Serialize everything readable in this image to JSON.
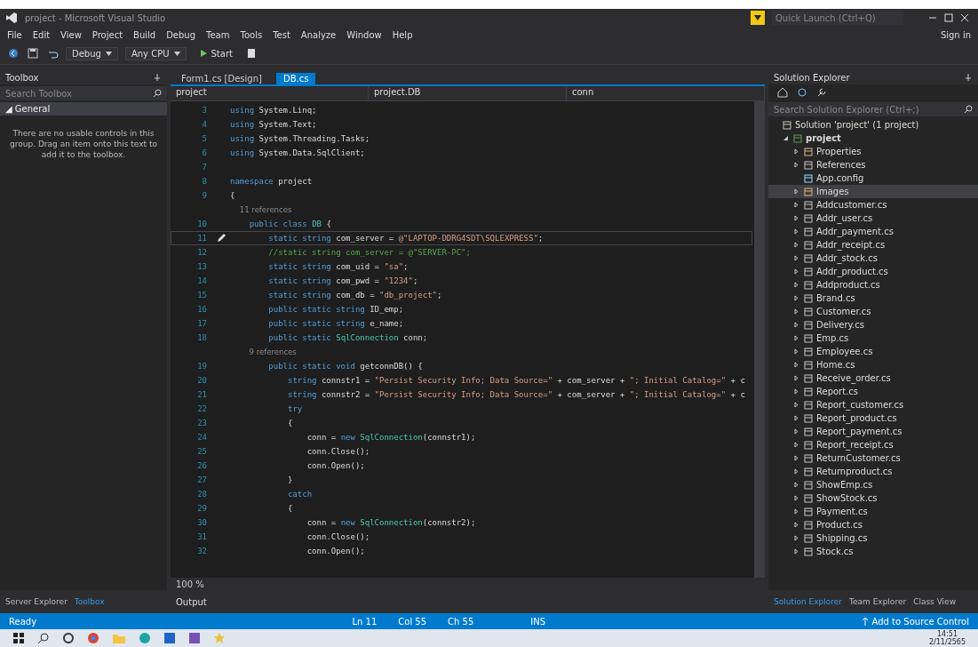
{
  "window": {
    "title": "project - Microsoft Visual Studio",
    "quick_launch": {
      "placeholder": "Quick Launch (Ctrl+Q)"
    },
    "sign_in": "Sign in"
  },
  "menu": [
    "File",
    "Edit",
    "View",
    "Project",
    "Build",
    "Debug",
    "Team",
    "Tools",
    "Test",
    "Analyze",
    "Window",
    "Help"
  ],
  "toolbar": {
    "configuration": "Debug",
    "platform": "Any CPU",
    "start": "Start"
  },
  "toolbox": {
    "title": "Toolbox",
    "search": {
      "placeholder": "Search Toolbox"
    },
    "group": "◢ General",
    "message": "There are no usable controls in this group. Drag an item onto this text to add it to the toolbox."
  },
  "editor": {
    "tabs": [
      {
        "label": "Form1.cs [Design]",
        "selected": false
      },
      {
        "label": "DB.cs",
        "selected": true
      }
    ],
    "nav": [
      "project",
      "project.DB",
      "conn"
    ],
    "lines": [
      {
        "kind": "code",
        "number": "3",
        "current": false,
        "parts": [
          {
            "kind": "kw",
            "text": "using "
          },
          {
            "kind": "plain",
            "text": "System.Linq;"
          }
        ]
      },
      {
        "kind": "code",
        "number": "4",
        "current": false,
        "parts": [
          {
            "kind": "kw",
            "text": "using "
          },
          {
            "kind": "plain",
            "text": "System.Text;"
          }
        ]
      },
      {
        "kind": "code",
        "number": "5",
        "current": false,
        "parts": [
          {
            "kind": "kw",
            "text": "using "
          },
          {
            "kind": "plain",
            "text": "System.Threading.Tasks;"
          }
        ]
      },
      {
        "kind": "code",
        "number": "6",
        "current": false,
        "parts": [
          {
            "kind": "kw",
            "text": "using "
          },
          {
            "kind": "plain",
            "text": "System.Data.SqlClient;"
          }
        ]
      },
      {
        "kind": "code",
        "number": "7",
        "current": false
      },
      {
        "kind": "code",
        "number": "8",
        "current": false,
        "parts": [
          {
            "kind": "kw",
            "text": "namespace "
          },
          {
            "kind": "plain",
            "text": "project"
          }
        ]
      },
      {
        "kind": "code",
        "number": "9",
        "current": false,
        "parts": [
          {
            "kind": "plain",
            "text": "{"
          }
        ]
      },
      {
        "kind": "lens",
        "current": false,
        "parts": [
          {
            "kind": "lens",
            "text": "    11 references"
          }
        ]
      },
      {
        "kind": "code",
        "number": "10",
        "current": false,
        "parts": [
          {
            "kind": "kw",
            "text": "    public class "
          },
          {
            "kind": "type",
            "text": "DB "
          },
          {
            "kind": "plain",
            "text": "{"
          }
        ]
      },
      {
        "kind": "code",
        "number": "11",
        "current": true,
        "parts": [
          {
            "kind": "kw",
            "text": "        static string "
          },
          {
            "kind": "plain",
            "text": "com_server = "
          },
          {
            "kind": "str",
            "text": "@\"LAPTOP-DDRG4SDT\\SQLEXPRESS\""
          },
          {
            "kind": "plain",
            "text": ";"
          }
        ]
      },
      {
        "kind": "code",
        "number": "12",
        "current": false,
        "parts": [
          {
            "kind": "comment",
            "text": "        //static string com_server = @\"SERVER-PC\";"
          }
        ]
      },
      {
        "kind": "code",
        "number": "13",
        "current": false,
        "parts": [
          {
            "kind": "kw",
            "text": "        static string "
          },
          {
            "kind": "plain",
            "text": "com_uid = "
          },
          {
            "kind": "str",
            "text": "\"sa\""
          },
          {
            "kind": "plain",
            "text": ";"
          }
        ]
      },
      {
        "kind": "code",
        "number": "14",
        "current": false,
        "parts": [
          {
            "kind": "kw",
            "text": "        static string "
          },
          {
            "kind": "plain",
            "text": "com_pwd = "
          },
          {
            "kind": "str",
            "text": "\"1234\""
          },
          {
            "kind": "plain",
            "text": ";"
          }
        ]
      },
      {
        "kind": "code",
        "number": "15",
        "current": false,
        "parts": [
          {
            "kind": "kw",
            "text": "        static string "
          },
          {
            "kind": "plain",
            "text": "com_db = "
          },
          {
            "kind": "str",
            "text": "\"db_project\""
          },
          {
            "kind": "plain",
            "text": ";"
          }
        ]
      },
      {
        "kind": "code",
        "number": "16",
        "current": false,
        "parts": [
          {
            "kind": "kw",
            "text": "        public static string "
          },
          {
            "kind": "plain",
            "text": "ID_emp;"
          }
        ]
      },
      {
        "kind": "code",
        "number": "17",
        "current": false,
        "parts": [
          {
            "kind": "kw",
            "text": "        public static string "
          },
          {
            "kind": "plain",
            "text": "e_name;"
          }
        ]
      },
      {
        "kind": "code",
        "number": "18",
        "current": false,
        "parts": [
          {
            "kind": "kw",
            "text": "        public static "
          },
          {
            "kind": "type",
            "text": "SqlConnection "
          },
          {
            "kind": "plain",
            "text": "conn;"
          }
        ]
      },
      {
        "kind": "lens",
        "current": false,
        "parts": [
          {
            "kind": "lens",
            "text": "        9 references"
          }
        ]
      },
      {
        "kind": "code",
        "number": "19",
        "current": false,
        "parts": [
          {
            "kind": "kw",
            "text": "        public static void "
          },
          {
            "kind": "plain",
            "text": "getconnDB() {"
          }
        ]
      },
      {
        "kind": "code",
        "number": "20",
        "current": false,
        "parts": [
          {
            "kind": "kw",
            "text": "            string "
          },
          {
            "kind": "plain",
            "text": "connstr1 = "
          },
          {
            "kind": "str",
            "text": "\"Persist Security Info; Data Source=\""
          },
          {
            "kind": "plain",
            "text": " + com_server + "
          },
          {
            "kind": "str",
            "text": "\"; Initial Catalog=\""
          },
          {
            "kind": "plain",
            "text": " + c"
          }
        ]
      },
      {
        "kind": "code",
        "number": "21",
        "current": false,
        "parts": [
          {
            "kind": "kw",
            "text": "            string "
          },
          {
            "kind": "plain",
            "text": "connstr2 = "
          },
          {
            "kind": "str",
            "text": "\"Persist Security Info; Data Source=\""
          },
          {
            "kind": "plain",
            "text": " + com_server + "
          },
          {
            "kind": "str",
            "text": "\"; Initial Catalog=\""
          },
          {
            "kind": "plain",
            "text": " + c"
          }
        ]
      },
      {
        "kind": "code",
        "number": "22",
        "current": false,
        "parts": [
          {
            "kind": "kw",
            "text": "            try"
          }
        ]
      },
      {
        "kind": "code",
        "number": "23",
        "current": false,
        "parts": [
          {
            "kind": "plain",
            "text": "            {"
          }
        ]
      },
      {
        "kind": "code",
        "number": "24",
        "current": false,
        "parts": [
          {
            "kind": "plain",
            "text": "                conn = "
          },
          {
            "kind": "kw",
            "text": "new "
          },
          {
            "kind": "type",
            "text": "SqlConnection"
          },
          {
            "kind": "plain",
            "text": "(connstr1);"
          }
        ]
      },
      {
        "kind": "code",
        "number": "25",
        "current": false,
        "parts": [
          {
            "kind": "plain",
            "text": "                conn.Close();"
          }
        ]
      },
      {
        "kind": "code",
        "number": "26",
        "current": false,
        "parts": [
          {
            "kind": "plain",
            "text": "                conn.Open();"
          }
        ]
      },
      {
        "kind": "code",
        "number": "27",
        "current": false,
        "parts": [
          {
            "kind": "plain",
            "text": "            }"
          }
        ]
      },
      {
        "kind": "code",
        "number": "28",
        "current": false,
        "parts": [
          {
            "kind": "kw",
            "text": "            catch"
          }
        ]
      },
      {
        "kind": "code",
        "number": "29",
        "current": false,
        "parts": [
          {
            "kind": "plain",
            "text": "            {"
          }
        ]
      },
      {
        "kind": "code",
        "number": "30",
        "current": false,
        "parts": [
          {
            "kind": "plain",
            "text": "                conn = "
          },
          {
            "kind": "kw",
            "text": "new "
          },
          {
            "kind": "type",
            "text": "SqlConnection"
          },
          {
            "kind": "plain",
            "text": "(connstr2);"
          }
        ]
      },
      {
        "kind": "code",
        "number": "31",
        "current": false,
        "parts": [
          {
            "kind": "plain",
            "text": "                conn.Close();"
          }
        ]
      },
      {
        "kind": "code",
        "number": "32",
        "current": false,
        "parts": [
          {
            "kind": "plain",
            "text": "                conn.Open();"
          }
        ]
      }
    ],
    "zoom": "100 %"
  },
  "solution_explorer": {
    "title": "Solution Explorer",
    "search": {
      "placeholder": "Search Solution Explorer (Ctrl+;)"
    },
    "tree": [
      {
        "label": "Solution 'project' (1 project)",
        "kind": "solution",
        "children": [
          {
            "label": "project",
            "kind": "project",
            "expanded": true,
            "selected": false,
            "children": [
              {
                "label": "Properties",
                "kind": "properties",
                "expanded": false,
                "selected": false
              },
              {
                "label": "References",
                "kind": "references",
                "expanded": false,
                "selected": false
              },
              {
                "label": "App.config",
                "kind": "config",
                "selected": false
              },
              {
                "label": "Images",
                "kind": "folder",
                "expanded": false,
                "selected": true
              },
              {
                "label": "Addcustomer.cs",
                "kind": "form",
                "expanded": false,
                "selected": false
              },
              {
                "label": "Addr_user.cs",
                "kind": "form",
                "expanded": false,
                "selected": false
              },
              {
                "label": "Addr_payment.cs",
                "kind": "form",
                "expanded": false,
                "selected": false
              },
              {
                "label": "Addr_receipt.cs",
                "kind": "form",
                "expanded": false,
                "selected": false
              },
              {
                "label": "Addr_stock.cs",
                "kind": "form",
                "expanded": false,
                "selected": false
              },
              {
                "label": "Addr_product.cs",
                "kind": "form",
                "expanded": false,
                "selected": false
              },
              {
                "label": "Addproduct.cs",
                "kind": "form",
                "expanded": false,
                "selected": false
              },
              {
                "label": "Brand.cs",
                "kind": "form",
                "expanded": false,
                "selected": false
              },
              {
                "label": "Customer.cs",
                "kind": "form",
                "expanded": false,
                "selected": false
              },
              {
                "label": "Delivery.cs",
                "kind": "form",
                "expanded": false,
                "selected": false
              },
              {
                "label": "Emp.cs",
                "kind": "form",
                "expanded": false,
                "selected": false
              },
              {
                "label": "Employee.cs",
                "kind": "form",
                "expanded": false,
                "selected": false
              },
              {
                "label": "Home.cs",
                "kind": "form",
                "expanded": false,
                "selected": false
              },
              {
                "label": "Receive_order.cs",
                "kind": "form",
                "expanded": false,
                "selected": false
              },
              {
                "label": "Report.cs",
                "kind": "form",
                "expanded": false,
                "selected": false
              },
              {
                "label": "Report_customer.cs",
                "kind": "form",
                "expanded": false,
                "selected": false
              },
              {
                "label": "Report_product.cs",
                "kind": "form",
                "expanded": false,
                "selected": false
              },
              {
                "label": "Report_payment.cs",
                "kind": "form",
                "expanded": false,
                "selected": false
              },
              {
                "label": "Report_receipt.cs",
                "kind": "form",
                "expanded": false,
                "selected": false
              },
              {
                "label": "ReturnCustomer.cs",
                "kind": "form",
                "expanded": false,
                "selected": false
              },
              {
                "label": "Returnproduct.cs",
                "kind": "form",
                "expanded": false,
                "selected": false
              },
              {
                "label": "ShowEmp.cs",
                "kind": "form",
                "expanded": false,
                "selected": false
              },
              {
                "label": "ShowStock.cs",
                "kind": "form",
                "expanded": false,
                "selected": false
              },
              {
                "label": "Payment.cs",
                "kind": "form",
                "expanded": false,
                "selected": false
              },
              {
                "label": "Product.cs",
                "kind": "form",
                "expanded": false,
                "selected": false
              },
              {
                "label": "Shipping.cs",
                "kind": "form",
                "expanded": false,
                "selected": false
              },
              {
                "label": "Stock.cs",
                "kind": "form",
                "expanded": false,
                "selected": false
              }
            ]
          }
        ]
      }
    ]
  },
  "bottom": {
    "left_tabs": [
      {
        "label": "Server Explorer",
        "selected": false
      },
      {
        "label": "Toolbox",
        "selected": true
      }
    ],
    "output_title": "Output",
    "right_tabs": [
      {
        "label": "Solution Explorer",
        "selected": true
      },
      {
        "label": "Team Explorer",
        "selected": false
      },
      {
        "label": "Class View",
        "selected": false
      }
    ]
  },
  "status_bar": {
    "state": "Ready",
    "line": "Ln 11",
    "column": "Col 55",
    "char": "Ch 55",
    "mode": "INS",
    "source_control": "Add to Source Control"
  },
  "taskbar": {
    "time": "14:51",
    "date": "2/11/2565"
  }
}
